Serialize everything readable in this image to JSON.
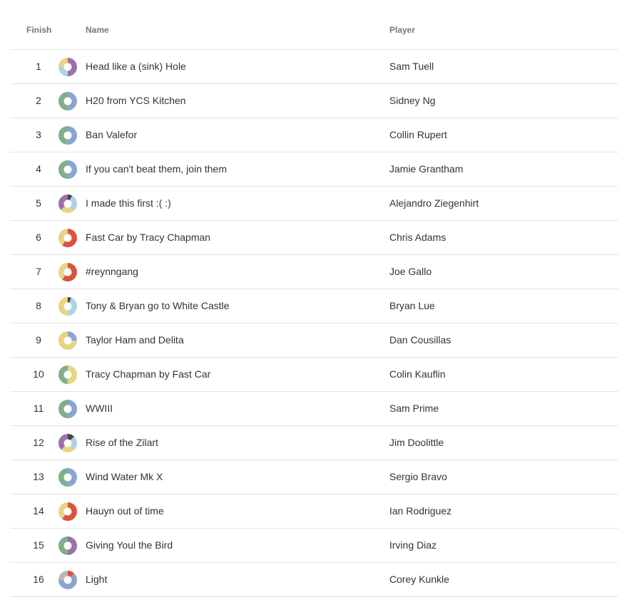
{
  "header": {
    "finish": "Finish",
    "name": "Name",
    "player": "Player"
  },
  "colors": {
    "purple": "#9b72a8",
    "lightblue": "#a8d4e6",
    "yellow": "#e8d483",
    "green": "#7fb08a",
    "blue": "#8ba4d1",
    "red": "#d9533f",
    "black": "#444444",
    "gray": "#b9b9b9"
  },
  "rows": [
    {
      "finish": "1",
      "name": "Head like a (sink) Hole",
      "player": "Sam Tuell",
      "icon": "deck-color-ring-icon",
      "ring": [
        [
          "purple",
          0.5
        ],
        [
          "lightblue",
          0.25
        ],
        [
          "yellow",
          0.25
        ]
      ]
    },
    {
      "finish": "2",
      "name": "H20 from YCS Kitchen",
      "player": "Sidney Ng",
      "icon": "deck-color-ring-icon",
      "ring": [
        [
          "blue",
          0.5
        ],
        [
          "green",
          0.5
        ]
      ]
    },
    {
      "finish": "3",
      "name": "Ban Valefor",
      "player": "Collin Rupert",
      "icon": "deck-color-ring-icon",
      "ring": [
        [
          "blue",
          0.5
        ],
        [
          "green",
          0.5
        ]
      ]
    },
    {
      "finish": "4",
      "name": "If you can't beat them, join them",
      "player": "Jamie Grantham",
      "icon": "deck-color-ring-icon",
      "ring": [
        [
          "blue",
          0.5
        ],
        [
          "green",
          0.5
        ]
      ]
    },
    {
      "finish": "5",
      "name": "I made this first :( :)",
      "player": "Alejandro Ziegenhirt",
      "icon": "deck-color-ring-icon",
      "ring": [
        [
          "black",
          0.08
        ],
        [
          "lightblue",
          0.3
        ],
        [
          "yellow",
          0.25
        ],
        [
          "purple",
          0.37
        ]
      ]
    },
    {
      "finish": "6",
      "name": "Fast Car by Tracy Chapman",
      "player": "Chris Adams",
      "icon": "deck-color-ring-icon",
      "ring": [
        [
          "red",
          0.6
        ],
        [
          "yellow",
          0.4
        ]
      ]
    },
    {
      "finish": "7",
      "name": "#reynngang",
      "player": "Joe Gallo",
      "icon": "deck-color-ring-icon",
      "ring": [
        [
          "red",
          0.6
        ],
        [
          "yellow",
          0.4
        ]
      ]
    },
    {
      "finish": "8",
      "name": "Tony & Bryan go to White Castle",
      "player": "Bryan Lue",
      "icon": "deck-color-ring-icon",
      "ring": [
        [
          "black",
          0.06
        ],
        [
          "lightblue",
          0.44
        ],
        [
          "yellow",
          0.5
        ]
      ]
    },
    {
      "finish": "9",
      "name": "Taylor Ham and Delita",
      "player": "Dan Cousillas",
      "icon": "deck-color-ring-icon",
      "ring": [
        [
          "blue",
          0.25
        ],
        [
          "yellow",
          0.75
        ]
      ]
    },
    {
      "finish": "10",
      "name": "Tracy Chapman by Fast Car",
      "player": "Colin Kauflin",
      "icon": "deck-color-ring-icon",
      "ring": [
        [
          "yellow",
          0.5
        ],
        [
          "green",
          0.5
        ]
      ]
    },
    {
      "finish": "11",
      "name": "WWIII",
      "player": "Sam Prime",
      "icon": "deck-color-ring-icon",
      "ring": [
        [
          "blue",
          0.5
        ],
        [
          "green",
          0.5
        ]
      ]
    },
    {
      "finish": "12",
      "name": "Rise of the Zilart",
      "player": "Jim Doolittle",
      "icon": "deck-color-ring-icon",
      "ring": [
        [
          "black",
          0.12
        ],
        [
          "lightblue",
          0.25
        ],
        [
          "yellow",
          0.25
        ],
        [
          "purple",
          0.38
        ]
      ]
    },
    {
      "finish": "13",
      "name": "Wind Water Mk X",
      "player": "Sergio Bravo",
      "icon": "deck-color-ring-icon",
      "ring": [
        [
          "blue",
          0.5
        ],
        [
          "green",
          0.5
        ]
      ]
    },
    {
      "finish": "14",
      "name": "Hauyn out of time",
      "player": "Ian Rodriguez",
      "icon": "deck-color-ring-icon",
      "ring": [
        [
          "red",
          0.6
        ],
        [
          "yellow",
          0.4
        ]
      ]
    },
    {
      "finish": "15",
      "name": "Giving Youl the Bird",
      "player": "Irving Diaz",
      "icon": "deck-color-ring-icon",
      "ring": [
        [
          "purple",
          0.5
        ],
        [
          "green",
          0.5
        ]
      ]
    },
    {
      "finish": "16",
      "name": "Light",
      "player": "Corey Kunkle",
      "icon": "deck-color-ring-icon",
      "ring": [
        [
          "red",
          0.12
        ],
        [
          "blue",
          0.63
        ],
        [
          "gray",
          0.25
        ]
      ]
    }
  ]
}
